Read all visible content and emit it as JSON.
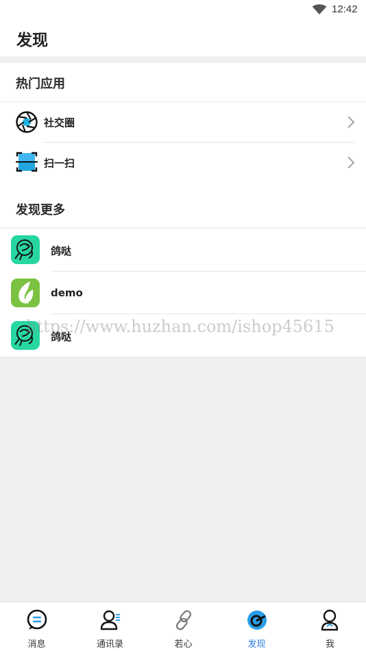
{
  "status_bar": {
    "time": "12:42"
  },
  "header": {
    "title": "发现"
  },
  "popular": {
    "title": "热门应用",
    "items": [
      {
        "label": "社交圈",
        "icon": "aperture-icon"
      },
      {
        "label": "扫一扫",
        "icon": "scan-icon"
      }
    ]
  },
  "more": {
    "title": "发现更多",
    "items": [
      {
        "label": "鸽哒",
        "icon": "bird-app-icon"
      },
      {
        "label": "demo",
        "icon": "leaf-app-icon"
      },
      {
        "label": "鸽哒",
        "icon": "bird-app-icon"
      }
    ]
  },
  "watermark": "https://www.huzhan.com/ishop45615",
  "tabbar": {
    "tabs": [
      {
        "label": "消息",
        "icon": "chat-icon"
      },
      {
        "label": "通讯录",
        "icon": "contacts-icon"
      },
      {
        "label": "若心",
        "icon": "link-icon"
      },
      {
        "label": "发现",
        "icon": "discover-icon",
        "active": true
      },
      {
        "label": "我",
        "icon": "profile-icon"
      }
    ],
    "active_color": "#2a7de1"
  }
}
